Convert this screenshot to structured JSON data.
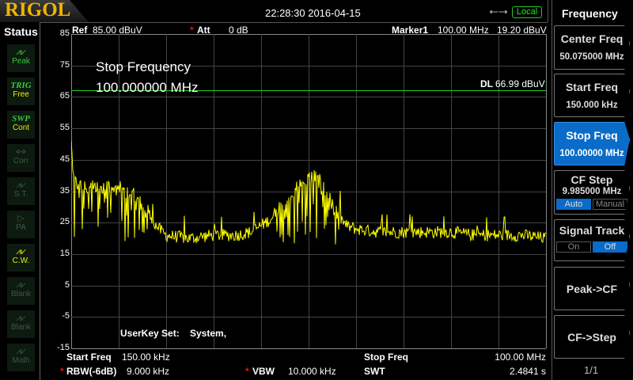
{
  "brand": "RIGOL",
  "datetime": "22:28:30 2016-04-15",
  "remote_status": "Local",
  "status": {
    "title": "Status",
    "items": [
      {
        "glyph": "⩘⩗",
        "label": "Peak",
        "state": "active-green"
      },
      {
        "glyph": "TRIG",
        "label": "Free",
        "state": "active-yellow"
      },
      {
        "glyph": "SWP",
        "label": "Cont",
        "state": "active-yellow"
      },
      {
        "glyph": "⋄⋄",
        "label": "Corr",
        "state": "dim"
      },
      {
        "glyph": "⩘⩗",
        "label": "S.T.",
        "state": "dim"
      },
      {
        "glyph": "▷",
        "label": "PA",
        "state": "dim"
      },
      {
        "glyph": "⩘⩗",
        "label": "C.W.",
        "state": "active-yellow"
      },
      {
        "glyph": "⩘⩗",
        "label": "Blank",
        "state": "dim"
      },
      {
        "glyph": "⩘⩗",
        "label": "Blank",
        "state": "dim"
      },
      {
        "glyph": "⩘⩗",
        "label": "Math",
        "state": "dim"
      }
    ]
  },
  "header": {
    "ref_label": "Ref",
    "ref_value": "85.00 dBuV",
    "att_label": "Att",
    "att_value": "0 dB",
    "marker_label": "Marker1",
    "marker_freq": "100.00 MHz",
    "marker_level": "19.20 dBuV"
  },
  "display_line": {
    "label": "DL",
    "value": "66.99 dBuV",
    "level": 66.99,
    "color": "#22cc22"
  },
  "annotation": {
    "line1": "Stop Frequency",
    "line2": "100.000000 MHz"
  },
  "userkey": {
    "label": "UserKey Set:",
    "value": "System,"
  },
  "footer": {
    "start_label": "Start Freq",
    "start_value": "150.00 kHz",
    "stop_label": "Stop Freq",
    "stop_value": "100.00 MHz",
    "rbw_label": "RBW(-6dB)",
    "rbw_value": "9.000 kHz",
    "vbw_label": "VBW",
    "vbw_value": "10.000 kHz",
    "swt_label": "SWT",
    "swt_value": "2.4841 s"
  },
  "chart_data": {
    "type": "line",
    "trace_color": "#ffff00",
    "xlim": [
      0.15,
      100
    ],
    "x_unit": "MHz",
    "ylim": [
      -15,
      85
    ],
    "y_unit": "dBuV",
    "yticks": [
      "85",
      "75",
      "65",
      "55",
      "45",
      "35",
      "25",
      "15",
      "5",
      "-5",
      "-15"
    ],
    "grid": true,
    "trace_envelope": {
      "x": [
        0.15,
        0.5,
        1.5,
        3,
        6,
        10,
        13,
        16,
        18,
        20,
        25,
        30,
        35,
        38,
        42,
        45,
        48,
        50,
        51,
        52,
        54,
        56,
        58,
        60,
        65,
        70,
        75,
        80,
        85,
        90,
        95,
        100
      ],
      "y": [
        52,
        40,
        37,
        36,
        37,
        36,
        34,
        29,
        24,
        21,
        20,
        21,
        21,
        22,
        26,
        31,
        37,
        39,
        40,
        39,
        34,
        28,
        24,
        23,
        22,
        22,
        22,
        22,
        21,
        21,
        21,
        20
      ]
    }
  },
  "menu": {
    "title": "Frequency",
    "buttons": [
      {
        "label": "Center Freq",
        "value": "50.075000 MHz"
      },
      {
        "label": "Start Freq",
        "value": "150.000 kHz"
      },
      {
        "label": "Stop Freq",
        "value": "100.00000 MHz",
        "active": true
      },
      {
        "label": "CF Step",
        "value": "9.985000 MHz",
        "options": [
          "Auto",
          "Manual"
        ],
        "selected": "Auto"
      },
      {
        "label": "Signal Track",
        "options": [
          "On",
          "Off"
        ],
        "selected": "Off"
      },
      {
        "label": "Peak->CF"
      },
      {
        "label": "CF->Step"
      }
    ],
    "page": "1/1"
  }
}
